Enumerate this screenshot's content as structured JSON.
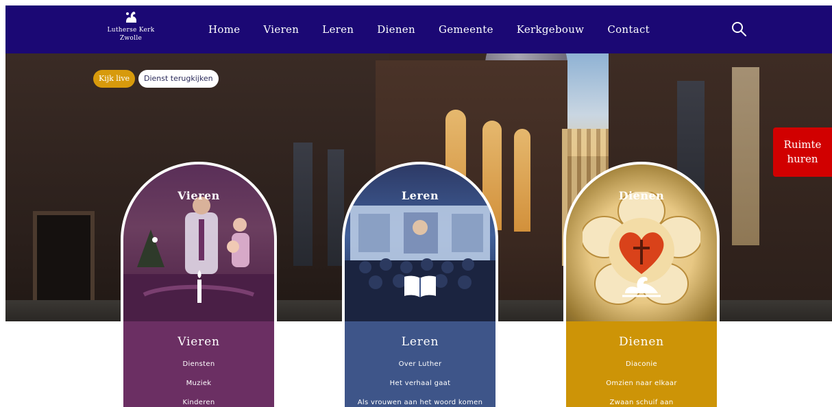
{
  "header": {
    "logo_line1": "Lutherse Kerk",
    "logo_line2": "Zwolle",
    "nav": [
      "Home",
      "Vieren",
      "Leren",
      "Dienen",
      "Gemeente",
      "Kerkgebouw",
      "Contact"
    ]
  },
  "hero": {
    "live_label": "Kijk live",
    "replay_label": "Dienst terugkijken",
    "rent_label_1": "Ruimte",
    "rent_label_2": "huren"
  },
  "cards": {
    "vieren": {
      "arch_title": "Vieren",
      "title": "Vieren",
      "links": [
        "Diensten",
        "Muziek",
        "Kinderen"
      ]
    },
    "leren": {
      "arch_title": "Leren",
      "title": "Leren",
      "links": [
        "Over Luther",
        "Het verhaal gaat",
        "Als vrouwen aan het woord komen"
      ]
    },
    "dienen": {
      "arch_title": "Dienen",
      "title": "Dienen",
      "links": [
        "Diaconie",
        "Omzien naar elkaar",
        "Zwaan schuif aan"
      ]
    }
  },
  "colors": {
    "header": "#1b0874",
    "vieren": "#6b2f63",
    "leren": "#3e5589",
    "dienen": "#cd9407",
    "rent": "#d10000",
    "live": "#d79a0c"
  }
}
